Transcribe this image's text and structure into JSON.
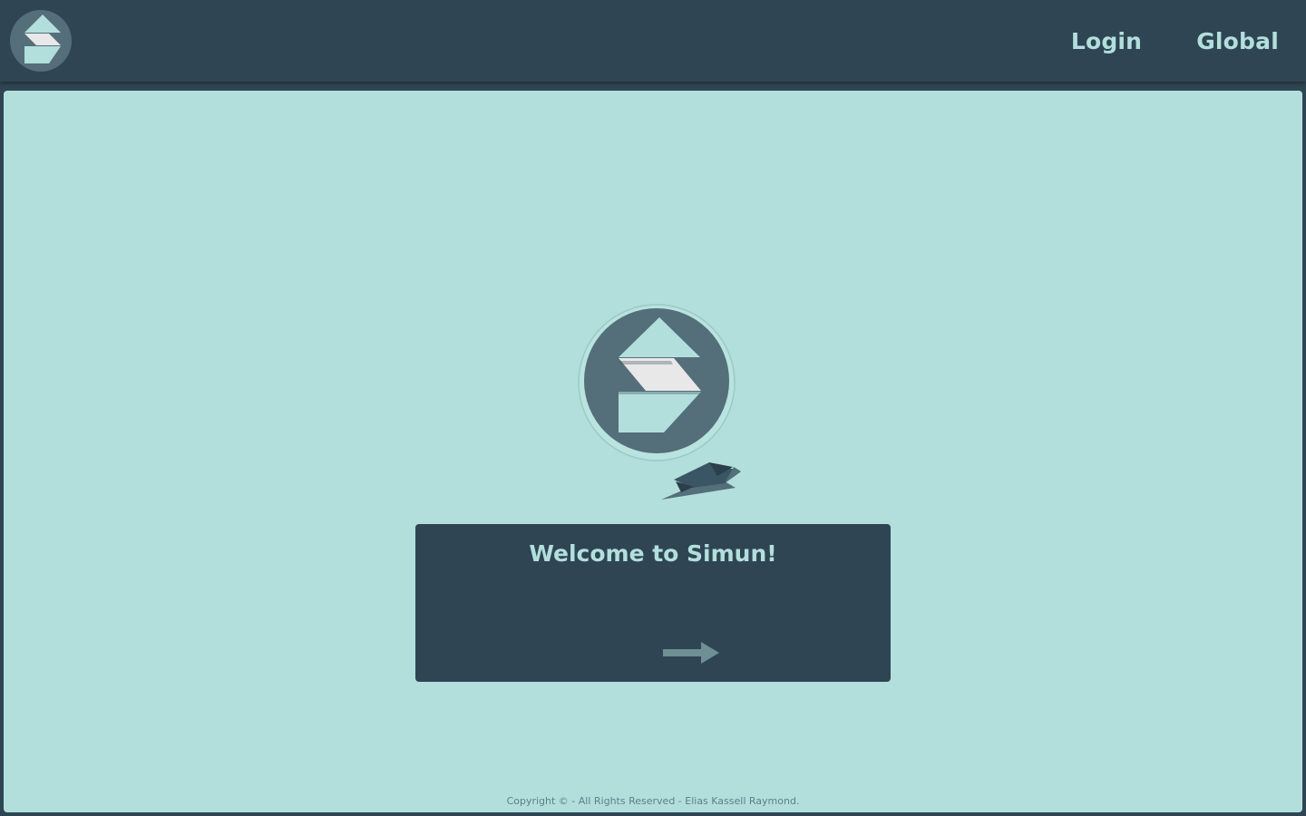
{
  "header": {
    "logo_icon": "simun-logo-icon",
    "nav": [
      {
        "label": "Login"
      },
      {
        "label": "Global"
      }
    ]
  },
  "hero": {
    "logo_icon": "simun-logo-icon",
    "decoration_icon": "paper-plane-icon"
  },
  "welcome": {
    "title": "Welcome to Simun!",
    "next_icon": "arrow-right-icon"
  },
  "footer": {
    "text": "Copyright © - All Rights Reserved - Elias Kassell Raymond."
  },
  "colors": {
    "header_bg": "#2f4553",
    "main_bg": "#b2dfdc",
    "accent_text": "#b2dfdc",
    "logo_circle": "#546e7a",
    "logo_light": "#b2dfdc",
    "logo_white": "#e8e8e8",
    "arrow": "#6e8f93"
  }
}
